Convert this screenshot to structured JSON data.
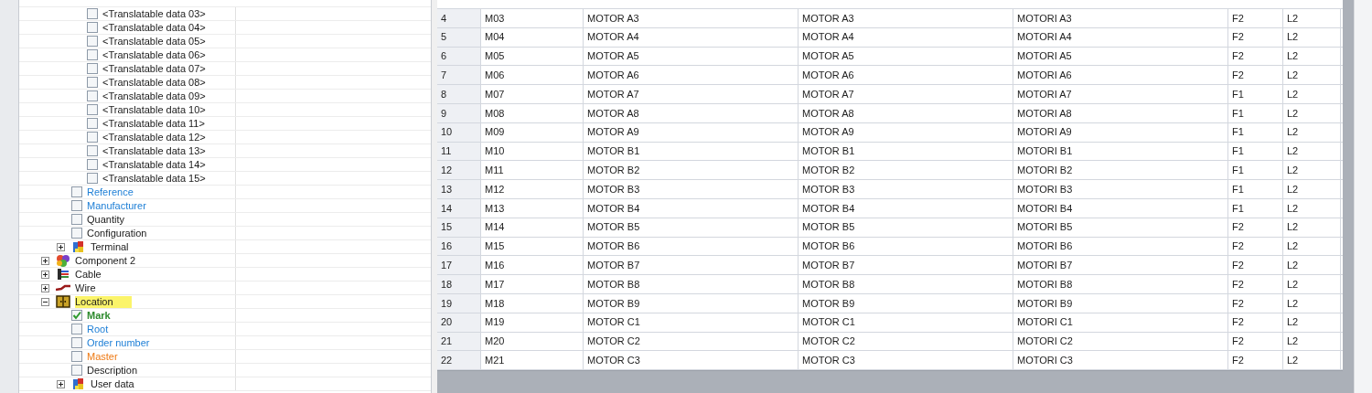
{
  "tree": {
    "items": [
      {
        "children": [
          {
            "children": [
              {
                "kind": "checkbox",
                "label": "<Translatable data 03>",
                "checked": false
              },
              {
                "kind": "checkbox",
                "label": "<Translatable data 04>",
                "checked": false
              },
              {
                "kind": "checkbox",
                "label": "<Translatable data 05>",
                "checked": false
              },
              {
                "kind": "checkbox",
                "label": "<Translatable data 06>",
                "checked": false
              },
              {
                "kind": "checkbox",
                "label": "<Translatable data 07>",
                "checked": false
              },
              {
                "kind": "checkbox",
                "label": "<Translatable data 08>",
                "checked": false
              },
              {
                "kind": "checkbox",
                "label": "<Translatable data 09>",
                "checked": false
              },
              {
                "kind": "checkbox",
                "label": "<Translatable data 10>",
                "checked": false
              },
              {
                "kind": "checkbox",
                "label": "<Translatable data 11>",
                "checked": false
              },
              {
                "kind": "checkbox",
                "label": "<Translatable data 12>",
                "checked": false
              },
              {
                "kind": "checkbox",
                "label": "<Translatable data 13>",
                "checked": false
              },
              {
                "kind": "checkbox",
                "label": "<Translatable data 14>",
                "checked": false
              },
              {
                "kind": "checkbox",
                "label": "<Translatable data 15>",
                "checked": false
              }
            ]
          },
          {
            "kind": "checkbox",
            "label": "Reference",
            "checked": false,
            "color": "#1e7fd6"
          },
          {
            "kind": "checkbox",
            "label": "Manufacturer",
            "checked": false,
            "color": "#1e7fd6"
          },
          {
            "kind": "checkbox",
            "label": "Quantity",
            "checked": false
          },
          {
            "kind": "checkbox",
            "label": "Configuration",
            "checked": false
          },
          {
            "kind": "terminal",
            "label": "Terminal",
            "expanded": false,
            "selected": false
          }
        ]
      },
      {
        "kind": "component",
        "label": "Component 2",
        "expanded": false,
        "selected": false
      },
      {
        "kind": "cable",
        "label": "Cable",
        "expanded": false,
        "selected": false
      },
      {
        "kind": "wire",
        "label": "Wire",
        "expanded": false,
        "selected": false
      },
      {
        "kind": "location",
        "label": "Location",
        "expanded": true,
        "selected": true,
        "children": [
          {
            "kind": "checkbox",
            "label": "Mark",
            "checked": true,
            "color": "#2e8b2e"
          },
          {
            "kind": "checkbox",
            "label": "Root",
            "checked": false,
            "color": "#1e7fd6"
          },
          {
            "kind": "checkbox",
            "label": "Order number",
            "checked": false,
            "color": "#1e7fd6"
          },
          {
            "kind": "checkbox",
            "label": "Master",
            "checked": false,
            "color": "#ee7a14"
          },
          {
            "kind": "checkbox",
            "label": "Description",
            "checked": false
          },
          {
            "kind": "terminal",
            "label": "User data",
            "expanded": false,
            "selected": false
          }
        ]
      }
    ]
  },
  "table": {
    "rows": [
      [
        "4",
        "M03",
        "MOTOR A3",
        "MOTOR A3",
        "MOTORI A3",
        "F2",
        "L2"
      ],
      [
        "5",
        "M04",
        "MOTOR A4",
        "MOTOR A4",
        "MOTORI A4",
        "F2",
        "L2"
      ],
      [
        "6",
        "M05",
        "MOTOR A5",
        "MOTOR A5",
        "MOTORI A5",
        "F2",
        "L2"
      ],
      [
        "7",
        "M06",
        "MOTOR A6",
        "MOTOR A6",
        "MOTORI A6",
        "F2",
        "L2"
      ],
      [
        "8",
        "M07",
        "MOTOR A7",
        "MOTOR A7",
        "MOTORI A7",
        "F1",
        "L2"
      ],
      [
        "9",
        "M08",
        "MOTOR A8",
        "MOTOR A8",
        "MOTORI A8",
        "F1",
        "L2"
      ],
      [
        "10",
        "M09",
        "MOTOR A9",
        "MOTOR A9",
        "MOTORI A9",
        "F1",
        "L2"
      ],
      [
        "11",
        "M10",
        "MOTOR B1",
        "MOTOR B1",
        "MOTORI B1",
        "F1",
        "L2"
      ],
      [
        "12",
        "M11",
        "MOTOR B2",
        "MOTOR B2",
        "MOTORI B2",
        "F1",
        "L2"
      ],
      [
        "13",
        "M12",
        "MOTOR B3",
        "MOTOR B3",
        "MOTORI B3",
        "F1",
        "L2"
      ],
      [
        "14",
        "M13",
        "MOTOR B4",
        "MOTOR B4",
        "MOTORI B4",
        "F1",
        "L2"
      ],
      [
        "15",
        "M14",
        "MOTOR B5",
        "MOTOR B5",
        "MOTORI B5",
        "F2",
        "L2"
      ],
      [
        "16",
        "M15",
        "MOTOR B6",
        "MOTOR B6",
        "MOTORI B6",
        "F2",
        "L2"
      ],
      [
        "17",
        "M16",
        "MOTOR B7",
        "MOTOR B7",
        "MOTORI B7",
        "F2",
        "L2"
      ],
      [
        "18",
        "M17",
        "MOTOR B8",
        "MOTOR B8",
        "MOTORI B8",
        "F2",
        "L2"
      ],
      [
        "19",
        "M18",
        "MOTOR B9",
        "MOTOR B9",
        "MOTORI B9",
        "F2",
        "L2"
      ],
      [
        "20",
        "M19",
        "MOTOR C1",
        "MOTOR C1",
        "MOTORI C1",
        "F2",
        "L2"
      ],
      [
        "21",
        "M20",
        "MOTOR C2",
        "MOTOR C2",
        "MOTORI C2",
        "F2",
        "L2"
      ],
      [
        "22",
        "M21",
        "MOTOR C3",
        "MOTOR C3",
        "MOTORI C3",
        "F2",
        "L2"
      ]
    ]
  }
}
